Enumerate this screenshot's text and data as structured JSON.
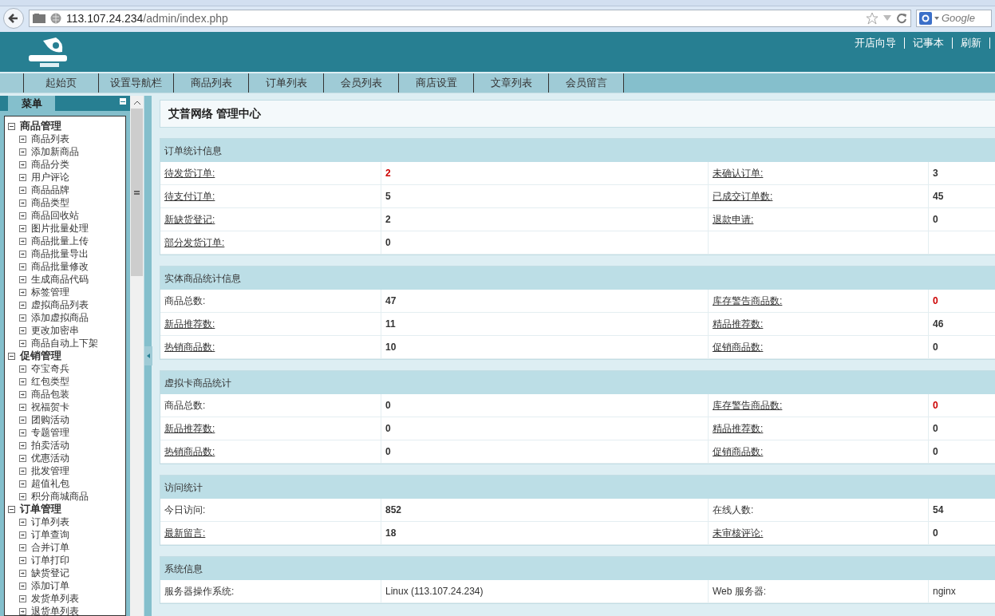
{
  "browser": {
    "url_host": "113.107.24.234",
    "url_path": "/admin/index.php",
    "search_placeholder": "Google"
  },
  "header": {
    "links": [
      "开店向导",
      "记事本",
      "刷新"
    ]
  },
  "nav": {
    "tabs": [
      "起始页",
      "设置导航栏",
      "商品列表",
      "订单列表",
      "会员列表",
      "商店设置",
      "文章列表",
      "会员留言"
    ]
  },
  "sidebar": {
    "title": "菜单",
    "groups": [
      {
        "label": "商品管理",
        "expanded": true,
        "children": [
          "商品列表",
          "添加新商品",
          "商品分类",
          "用户评论",
          "商品品牌",
          "商品类型",
          "商品回收站",
          "图片批量处理",
          "商品批量上传",
          "商品批量导出",
          "商品批量修改",
          "生成商品代码",
          "标签管理",
          "虚拟商品列表",
          "添加虚拟商品",
          "更改加密串",
          "商品自动上下架"
        ]
      },
      {
        "label": "促销管理",
        "expanded": true,
        "children": [
          "夺宝奇兵",
          "红包类型",
          "商品包装",
          "祝福贺卡",
          "团购活动",
          "专题管理",
          "拍卖活动",
          "优惠活动",
          "批发管理",
          "超值礼包",
          "积分商城商品"
        ]
      },
      {
        "label": "订单管理",
        "expanded": true,
        "children": [
          "订单列表",
          "订单查询",
          "合并订单",
          "订单打印",
          "缺货登记",
          "添加订单",
          "发货单列表",
          "退货单列表"
        ]
      }
    ]
  },
  "main": {
    "title": "艾普网络 管理中心",
    "sections": [
      {
        "title": "订单统计信息",
        "rows": [
          {
            "pairs": [
              {
                "label": "待发货订单:",
                "link": true,
                "value": "2",
                "alert": true
              },
              {
                "label": "未确认订单:",
                "link": true,
                "value": "3",
                "alert": false
              }
            ]
          },
          {
            "pairs": [
              {
                "label": "待支付订单:",
                "link": true,
                "value": "5",
                "alert": false
              },
              {
                "label": "已成交订单数:",
                "link": true,
                "value": "45",
                "alert": false
              }
            ]
          },
          {
            "pairs": [
              {
                "label": "新缺货登记:",
                "link": true,
                "value": "2",
                "alert": false
              },
              {
                "label": "退款申请:",
                "link": true,
                "value": "0",
                "alert": false
              }
            ]
          },
          {
            "pairs": [
              {
                "label": "部分发货订单:",
                "link": true,
                "value": "0",
                "alert": false
              }
            ]
          }
        ]
      },
      {
        "title": "实体商品统计信息",
        "rows": [
          {
            "pairs": [
              {
                "label": "商品总数:",
                "link": false,
                "value": "47",
                "alert": false
              },
              {
                "label": "库存警告商品数:",
                "link": true,
                "value": "0",
                "alert": true
              }
            ]
          },
          {
            "pairs": [
              {
                "label": "新品推荐数:",
                "link": true,
                "value": "11",
                "alert": false
              },
              {
                "label": "精品推荐数:",
                "link": true,
                "value": "46",
                "alert": false
              }
            ]
          },
          {
            "pairs": [
              {
                "label": "热销商品数:",
                "link": true,
                "value": "10",
                "alert": false
              },
              {
                "label": "促销商品数:",
                "link": true,
                "value": "0",
                "alert": false
              }
            ]
          }
        ]
      },
      {
        "title": "虚拟卡商品统计",
        "rows": [
          {
            "pairs": [
              {
                "label": "商品总数:",
                "link": false,
                "value": "0",
                "alert": false
              },
              {
                "label": "库存警告商品数:",
                "link": true,
                "value": "0",
                "alert": true
              }
            ]
          },
          {
            "pairs": [
              {
                "label": "新品推荐数:",
                "link": true,
                "value": "0",
                "alert": false
              },
              {
                "label": "精品推荐数:",
                "link": true,
                "value": "0",
                "alert": false
              }
            ]
          },
          {
            "pairs": [
              {
                "label": "热销商品数:",
                "link": true,
                "value": "0",
                "alert": false
              },
              {
                "label": "促销商品数:",
                "link": true,
                "value": "0",
                "alert": false
              }
            ]
          }
        ]
      },
      {
        "title": "访问统计",
        "rows": [
          {
            "pairs": [
              {
                "label": "今日访问:",
                "link": false,
                "value": "852",
                "alert": false
              },
              {
                "label": "在线人数:",
                "link": false,
                "value": "54",
                "alert": false
              }
            ]
          },
          {
            "pairs": [
              {
                "label": "最新留言:",
                "link": true,
                "value": "18",
                "alert": false
              },
              {
                "label": "未审核评论:",
                "link": true,
                "value": "0",
                "alert": false
              }
            ]
          }
        ]
      },
      {
        "title": "系统信息",
        "rows": [
          {
            "pairs": [
              {
                "label": "服务器操作系统:",
                "link": false,
                "value": "Linux (113.107.24.234)",
                "alert": false,
                "plain": true
              },
              {
                "label": "Web 服务器:",
                "link": false,
                "value": "nginx",
                "alert": false,
                "plain": true
              }
            ]
          }
        ]
      }
    ]
  }
}
